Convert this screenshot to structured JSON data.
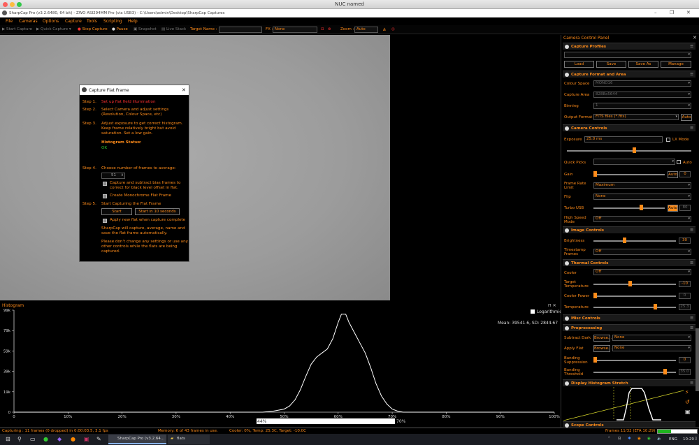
{
  "window": {
    "mac_title": "NUC named",
    "app_title": "SharpCap Pro (v3.2.6480, 64 bit) - ZWO ASI294MM Pro (via USB3) - C:\\Users\\admin\\Desktop\\SharpCap Captures"
  },
  "menu": [
    "File",
    "Cameras",
    "Options",
    "Capture",
    "Tools",
    "Scripting",
    "Help"
  ],
  "toolbar": {
    "start_capture": "Start Capture",
    "quick_capture": "Quick Capture",
    "stop_capture": "Stop Capture",
    "pause": "Pause",
    "snapshot": "Snapshot",
    "live_stack": "Live Stack",
    "target_name_label": "Target Name :",
    "fx_label": "FX :",
    "fx_value": "None",
    "zoom_label": "Zoom :",
    "zoom_value": "Auto"
  },
  "dialog": {
    "title": "Capture Flat Frame",
    "close": "✕",
    "step1_label": "Step 1.",
    "step1_text": "Set up flat field illumination",
    "step2_label": "Step 2.",
    "step2_text": "Select Camera and adjust settings (Resolution, Colour Space, etc)",
    "step3_label": "Step 3.",
    "step3_text": "Adjust exposure to get correct histogram. Keep frame relatively bright but avoid saturation. Set a low gain.",
    "hist_status_label": "Histogram Status:",
    "hist_status_value": "OK",
    "step4_label": "Step 4.",
    "step4_text": "Choose number of frames to average:",
    "frames_value": "51",
    "bias_text": "Capture and subtract bias frames to correct for black level offset in flat.",
    "mono_text": "Create Monochrome Flat Frame",
    "step5_label": "Step 5.",
    "step5_text": "Start Capturing the Flat Frame",
    "start_btn": "Start",
    "start10_btn": "Start in 10 seconds",
    "apply_text": "Apply new flat when capture complete",
    "info1": "SharpCap will capture, average, name and save the flat frame automatically.",
    "info2": "Please don't change any settings or use any other controls while the flats are being captured."
  },
  "histogram": {
    "title": "Histogram",
    "logarithmic": "Logarithmic",
    "stats": "Mean: 39541.6, SD: 2844.67",
    "y_ticks": [
      "99k",
      "79k",
      "59k",
      "39k",
      "19k",
      "0"
    ],
    "x_ticks": [
      "0",
      "10%",
      "20%",
      "30%",
      "40%",
      "50%",
      "60%",
      "70%",
      "80%",
      "90%",
      "100%"
    ],
    "range_left": "44%",
    "range_right": "70%",
    "curve": [
      [
        0,
        0
      ],
      [
        46,
        0
      ],
      [
        48,
        0.01
      ],
      [
        50,
        0.03
      ],
      [
        51,
        0.06
      ],
      [
        52,
        0.12
      ],
      [
        53,
        0.22
      ],
      [
        54,
        0.35
      ],
      [
        55,
        0.47
      ],
      [
        56,
        0.54
      ],
      [
        57,
        0.58
      ],
      [
        58,
        0.62
      ],
      [
        59,
        0.72
      ],
      [
        60,
        0.88
      ],
      [
        60.6,
        0.96
      ],
      [
        61.4,
        0.96
      ],
      [
        62,
        0.88
      ],
      [
        63,
        0.78
      ],
      [
        64,
        0.68
      ],
      [
        65,
        0.58
      ],
      [
        66,
        0.44
      ],
      [
        67,
        0.28
      ],
      [
        68,
        0.16
      ],
      [
        69,
        0.08
      ],
      [
        70,
        0.03
      ],
      [
        71,
        0.01
      ],
      [
        72,
        0
      ],
      [
        100,
        0
      ]
    ]
  },
  "panel": {
    "title": "Camera Control Panel",
    "close": "✕",
    "capture_profiles": "Capture Profiles",
    "load": "Load",
    "save": "Save",
    "save_as": "Save As",
    "manage": "Manage",
    "capture_format": "Capture Format and Area",
    "colour_space_label": "Colour Space",
    "colour_space_value": "MONO16",
    "capture_area_label": "Capture Area",
    "capture_area_value": "8288x5644",
    "binning_label": "Binning",
    "binning_value": "1",
    "output_format_label": "Output Format",
    "output_format_value": "FITS files (*.fits)",
    "output_auto": "Auto",
    "camera_controls": "Camera Controls",
    "exposure_label": "Exposure",
    "exposure_value": "25.0 ms",
    "lx_mode": "LX Mode",
    "quick_picks_label": "Quick Picks",
    "auto": "Auto",
    "gain_label": "Gain",
    "gain_value": "0",
    "frame_rate_label": "Frame Rate Limit",
    "frame_rate_value": "Maximum",
    "flip_label": "Flip",
    "flip_value": "None",
    "turbo_label": "Turbo USB",
    "turbo_value": "80",
    "high_speed_label": "High Speed Mode",
    "high_speed_value": "Off",
    "image_controls": "Image Controls",
    "brightness_label": "Brightness",
    "brightness_value": "30",
    "timestamp_label": "Timestamp Frames",
    "timestamp_value": "Off",
    "thermal_controls": "Thermal Controls",
    "cooler_label": "Cooler",
    "cooler_value": "Off",
    "target_temp_label": "Target Temperature",
    "target_temp_value": "-10",
    "cooler_power_label": "Cooler Power",
    "cooler_power_value": "0",
    "temperature_label": "Temperature",
    "temperature_value": "25.3",
    "misc_controls": "Misc Controls",
    "preprocessing": "Preprocessing",
    "subtract_dark_label": "Subtract Dark",
    "browse": "Browse...",
    "none": "None",
    "apply_flat_label": "Apply Flat",
    "banding_supp_label": "Banding Suppression",
    "banding_supp_value": "0",
    "banding_thresh_label": "Banding Threshold",
    "banding_thresh_value": "35.0",
    "display_stretch": "Display Histogram Stretch",
    "scope_controls": "Scope Controls"
  },
  "status": {
    "capturing": "Capturing : 11 frames (0 dropped) in 0:00:03.5, 3.1 fps",
    "memory": "Memory: 6 of 43 frames in use.",
    "cooler": "Cooler: 0%, Temp: 25.3C, Target: -10.0C",
    "frames": "Frames 11/32 (ETA 10:29)",
    "progress": 0.34
  },
  "taskbar": {
    "app_item": "SharpCap Pro (v3.2.64...",
    "folder_item": "flats",
    "lang": "ENG",
    "time": "10:29"
  },
  "colors": {
    "accent": "#ff8c1a",
    "ok": "#2ec12e",
    "warn": "#ff3030"
  }
}
